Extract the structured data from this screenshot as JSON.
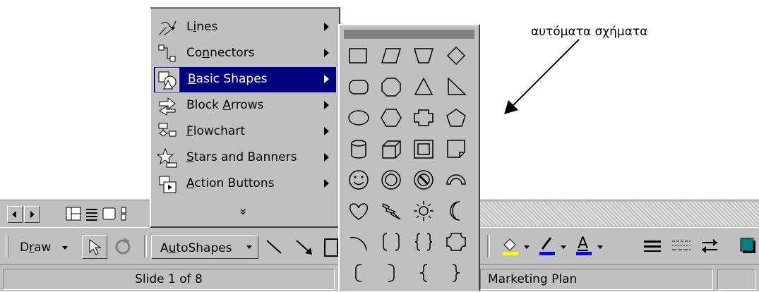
{
  "annotation": {
    "text": "αυτόματα σχήματα"
  },
  "menu": {
    "items": [
      {
        "label": "Lines",
        "icon": "lines-icon"
      },
      {
        "label": "Connectors",
        "icon": "connectors-icon"
      },
      {
        "label": "Basic Shapes",
        "icon": "basic-shapes-icon",
        "highlighted": true
      },
      {
        "label": "Block Arrows",
        "icon": "block-arrows-icon"
      },
      {
        "label": "Flowchart",
        "icon": "flowchart-icon"
      },
      {
        "label": "Stars and Banners",
        "icon": "stars-banners-icon"
      },
      {
        "label": "Action Buttons",
        "icon": "action-buttons-icon"
      }
    ],
    "expand_glyph": "»"
  },
  "submenu": {
    "shapes": [
      "rectangle",
      "parallelogram",
      "trapezoid",
      "diamond",
      "rounded-rectangle",
      "octagon",
      "isosceles-triangle",
      "right-triangle",
      "oval",
      "hexagon",
      "cross",
      "regular-pentagon",
      "can",
      "cube",
      "bevel",
      "folded-corner",
      "smiley-face",
      "donut",
      "no-symbol",
      "block-arc",
      "heart",
      "lightning-bolt",
      "sun",
      "moon",
      "arc",
      "double-bracket",
      "double-brace",
      "plaque",
      "left-bracket",
      "right-bracket",
      "left-brace",
      "right-brace"
    ]
  },
  "drawing_toolbar": {
    "draw_label": "Draw",
    "autoshapes_label": "AutoShapes",
    "icons": [
      "select-arrow-icon",
      "free-rotate-icon",
      "line-icon",
      "arrow-icon",
      "rectangle-icon",
      "fill-color-icon",
      "line-color-icon",
      "font-color-icon",
      "line-style-icon",
      "dash-style-icon",
      "arrow-style-icon",
      "shadow-icon"
    ],
    "font_color_glyph": "A"
  },
  "status_bar": {
    "slide": "Slide 1 of 8",
    "design": "Marketing Plan"
  },
  "colors": {
    "highlight": "#000080",
    "face": "#c0c0c0",
    "fill_color": "#ffff00",
    "line_color": "#0000ff",
    "font_color": "#0000ff"
  }
}
